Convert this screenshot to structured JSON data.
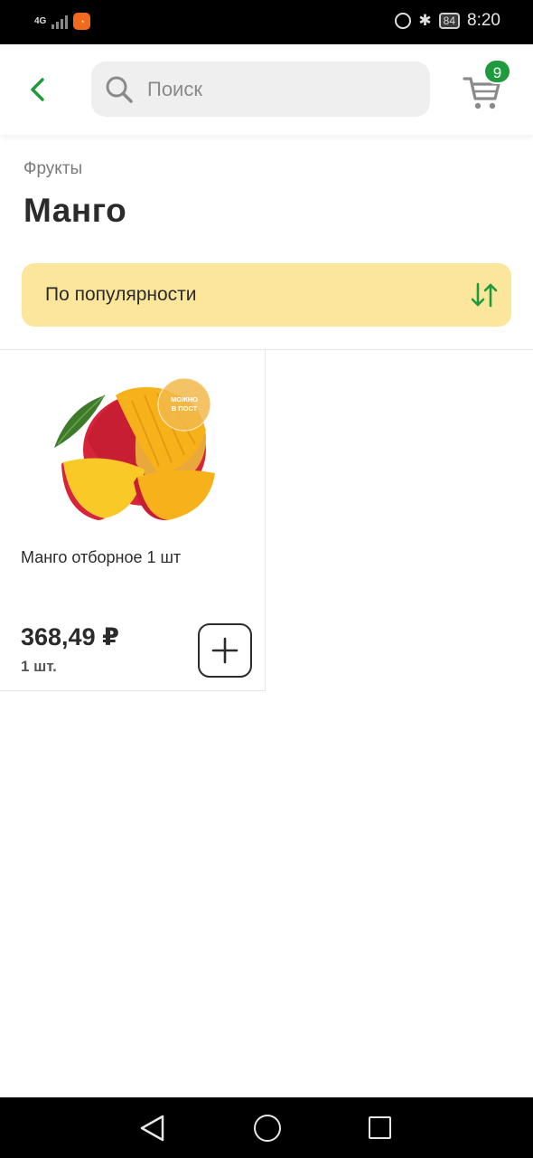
{
  "status_bar": {
    "network": "4G",
    "time": "8:20",
    "battery": "84"
  },
  "header": {
    "search_placeholder": "Поиск",
    "cart_count": "9"
  },
  "breadcrumb": "Фрукты",
  "page_title": "Манго",
  "sort": {
    "label": "По популярности"
  },
  "products": [
    {
      "name": "Манго отборное 1 шт",
      "price": "368,49 ₽",
      "unit": "1 шт.",
      "badge_text": "МОЖНО В ПОСТ"
    }
  ],
  "colors": {
    "accent_green": "#1f9a3d",
    "sort_background": "#fbe69c",
    "text_dark": "#2b2b2b",
    "search_background": "#efefef"
  }
}
